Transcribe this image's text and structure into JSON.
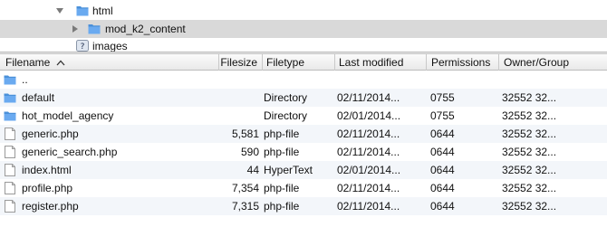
{
  "tree": {
    "items": [
      {
        "label": "html",
        "expanded": true,
        "icon": "folder-icon"
      },
      {
        "label": "mod_k2_content",
        "expanded": false,
        "icon": "folder-icon",
        "selected": true
      },
      {
        "label": "images",
        "icon": "unknown-folder-icon"
      }
    ]
  },
  "list": {
    "columns": [
      {
        "key": "name",
        "label": "Filename",
        "sorted": "ascending"
      },
      {
        "key": "size",
        "label": "Filesize"
      },
      {
        "key": "type",
        "label": "Filetype"
      },
      {
        "key": "modified",
        "label": "Last modified"
      },
      {
        "key": "perms",
        "label": "Permissions"
      },
      {
        "key": "owner",
        "label": "Owner/Group"
      }
    ],
    "rows": [
      {
        "name": "..",
        "size": "",
        "type": "",
        "modified": "",
        "perms": "",
        "owner": "",
        "icon": "folder-icon"
      },
      {
        "name": "default",
        "size": "",
        "type": "Directory",
        "modified": "02/11/2014...",
        "perms": "0755",
        "owner": "32552 32...",
        "icon": "folder-icon"
      },
      {
        "name": "hot_model_agency",
        "size": "",
        "type": "Directory",
        "modified": "02/01/2014...",
        "perms": "0755",
        "owner": "32552 32...",
        "icon": "folder-icon"
      },
      {
        "name": "generic.php",
        "size": "5,581",
        "type": "php-file",
        "modified": "02/11/2014...",
        "perms": "0644",
        "owner": "32552 32...",
        "icon": "file-icon"
      },
      {
        "name": "generic_search.php",
        "size": "590",
        "type": "php-file",
        "modified": "02/11/2014...",
        "perms": "0644",
        "owner": "32552 32...",
        "icon": "file-icon"
      },
      {
        "name": "index.html",
        "size": "44",
        "type": "HyperText",
        "modified": "02/01/2014...",
        "perms": "0644",
        "owner": "32552 32...",
        "icon": "file-icon"
      },
      {
        "name": "profile.php",
        "size": "7,354",
        "type": "php-file",
        "modified": "02/11/2014...",
        "perms": "0644",
        "owner": "32552 32...",
        "icon": "file-icon"
      },
      {
        "name": "register.php",
        "size": "7,315",
        "type": "php-file",
        "modified": "02/11/2014...",
        "perms": "0644",
        "owner": "32552 32...",
        "icon": "file-icon"
      }
    ]
  },
  "colors": {
    "folder": "#4a90d9",
    "selection": "#d9d9d9",
    "alt_row": "#f3f6fa"
  }
}
